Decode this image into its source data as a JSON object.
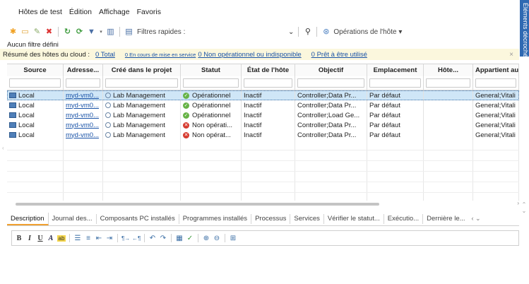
{
  "menu": [
    "Hôtes de test",
    "Édition",
    "Affichage",
    "Favoris"
  ],
  "toolbar": {
    "filter_label": "Filtres rapides :",
    "operations_label": "Opérations de l'hôte",
    "icons": [
      "new-host-icon",
      "open-folder-icon",
      "edit-icon",
      "delete-icon",
      "refresh-icon",
      "refresh-all-icon",
      "filter-icon",
      "grid-columns-icon",
      "quick-filter-icon",
      "search-icon",
      "operations-icon"
    ]
  },
  "no_filter": "Aucun filtre défini",
  "summary": {
    "label": "Résumé des hôtes du cloud :",
    "total": "0 Total",
    "in_service": "0 En cours de mise en service",
    "non_operational": "0 Non opérationnel ou indisponible",
    "ready": "0 Prêt à être utilisé",
    "close": "×"
  },
  "columns": [
    "Source",
    "Adresse...",
    "Créé dans le projet",
    "Statut",
    "État de l'hôte",
    "Objectif",
    "Emplacement",
    "Hôte...",
    "Appartient aux"
  ],
  "rows": [
    {
      "source": "Local",
      "address": "myd-vm0...",
      "project": "Lab Management",
      "status": "Opérationnel",
      "status_ok": true,
      "state": "Inactif",
      "purpose": "Controller;Data Pr...",
      "location": "Par défaut",
      "host": "",
      "pools": "General;Vitali"
    },
    {
      "source": "Local",
      "address": "myd-vm0...",
      "project": "Lab Management",
      "status": "Opérationnel",
      "status_ok": true,
      "state": "Inactif",
      "purpose": "Controller;Data Pr...",
      "location": "Par défaut",
      "host": "",
      "pools": "General;Vitali"
    },
    {
      "source": "Local",
      "address": "myd-vm0...",
      "project": "Lab Management",
      "status": "Opérationnel",
      "status_ok": true,
      "state": "Inactif",
      "purpose": "Controller;Load Ge...",
      "location": "Par défaut",
      "host": "",
      "pools": "General;Vitali"
    },
    {
      "source": "Local",
      "address": "myd-vm0...",
      "project": "Lab Management",
      "status": "Non opérati...",
      "status_ok": false,
      "state": "Inactif",
      "purpose": "Controller;Data Pr...",
      "location": "Par défaut",
      "host": "",
      "pools": "General;Vitali"
    },
    {
      "source": "Local",
      "address": "myd-vm0...",
      "project": "Lab Management",
      "status": "Non opérat...",
      "status_ok": false,
      "state": "Inactif",
      "purpose": "Controller;Data Pr...",
      "location": "Par défaut",
      "host": "",
      "pools": "General;Vitali"
    }
  ],
  "tabs": [
    "Description",
    "Journal des...",
    "Composants PC installés",
    "Programmes installés",
    "Processus",
    "Services",
    "Vérifier le statut...",
    "Exécutio...",
    "Dernière le..."
  ],
  "side_panel": "Éléments décrochés",
  "colors": {
    "summary_bg": "#fbf7dd",
    "selected_row": "#cfe6f7",
    "link": "#1a53a7",
    "ok": "#67b346",
    "error": "#d63a2e",
    "accent_tab": "#f0a030",
    "side_tab": "#2f69b2"
  }
}
